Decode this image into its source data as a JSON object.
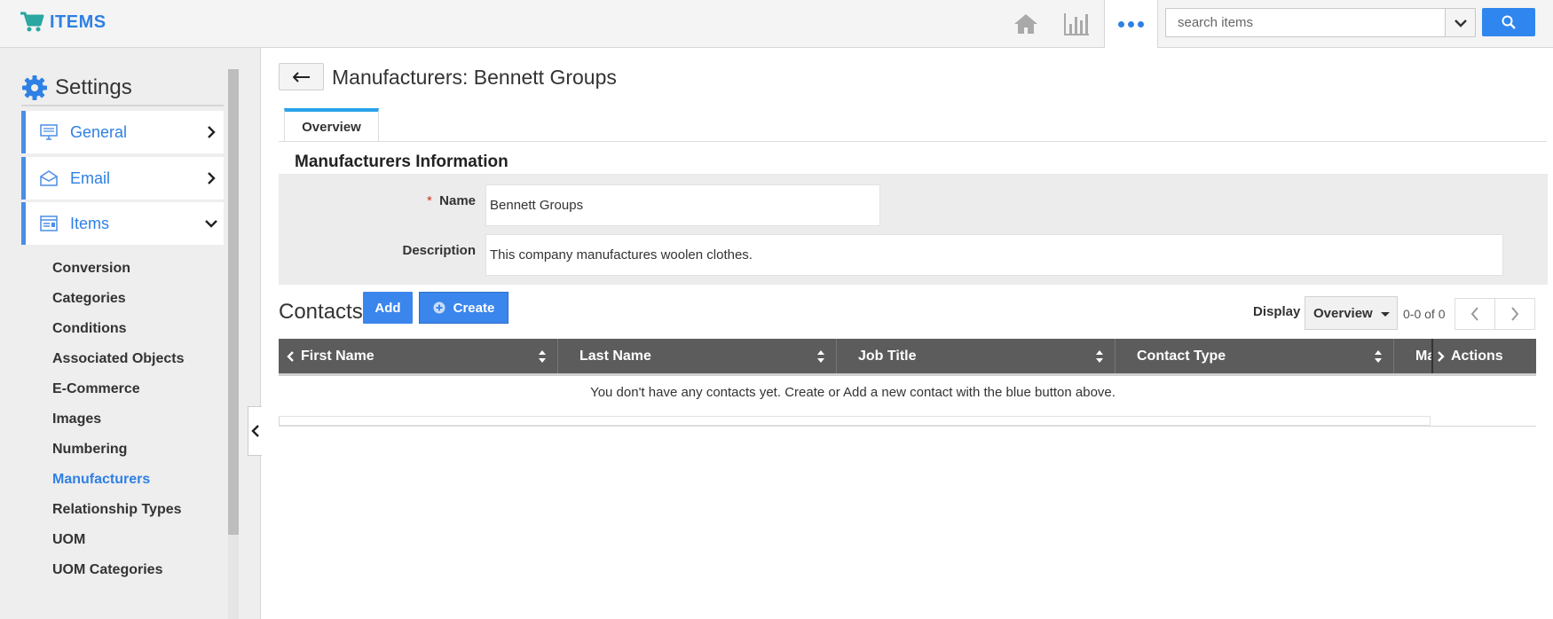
{
  "app": {
    "title": "ITEMS",
    "brand_color": "#2f80e4",
    "icons": [
      "cart-icon",
      "home-icon",
      "bar-chart-icon",
      "more-dots-icon"
    ]
  },
  "search": {
    "placeholder": "search items",
    "value": ""
  },
  "sidebar": {
    "title": "Settings",
    "main_items": [
      {
        "label": "General",
        "icon": "monitor-icon",
        "state": "collapsed"
      },
      {
        "label": "Email",
        "icon": "envelope-icon",
        "state": "collapsed"
      },
      {
        "label": "Items",
        "icon": "items-list-icon",
        "state": "expanded"
      }
    ],
    "sub_items": [
      {
        "label": "Conversion"
      },
      {
        "label": "Categories"
      },
      {
        "label": "Conditions"
      },
      {
        "label": "Associated Objects"
      },
      {
        "label": "E-Commerce"
      },
      {
        "label": "Images"
      },
      {
        "label": "Numbering"
      },
      {
        "label": "Manufacturers",
        "active": true
      },
      {
        "label": "Relationship Types"
      },
      {
        "label": "UOM"
      },
      {
        "label": "UOM Categories"
      }
    ]
  },
  "page": {
    "title": "Manufacturers: Bennett Groups",
    "tabs": [
      {
        "label": "Overview",
        "active": true
      }
    ]
  },
  "info": {
    "section_title": "Manufacturers Information",
    "required_mark": "*",
    "name_label": "Name",
    "name_value": "Bennett Groups",
    "description_label": "Description",
    "description_value": "This company manufactures woolen clothes."
  },
  "contacts": {
    "title": "Contacts",
    "add_label": "Add",
    "create_label": "Create",
    "display_label": "Display",
    "display_value": "Overview",
    "page_count": "0-0 of 0",
    "columns": [
      "First Name",
      "Last Name",
      "Job Title",
      "Contact Type",
      "Ma",
      "Actions"
    ],
    "empty_message": "You don't have any contacts yet. Create or Add a new contact with the blue button above."
  },
  "colors": {
    "accent": "#2f80e4",
    "button_blue": "#3b86ec",
    "table_header": "#5c5c5c",
    "tab_indicator": "#29a3ea",
    "required": "#d9341c"
  }
}
